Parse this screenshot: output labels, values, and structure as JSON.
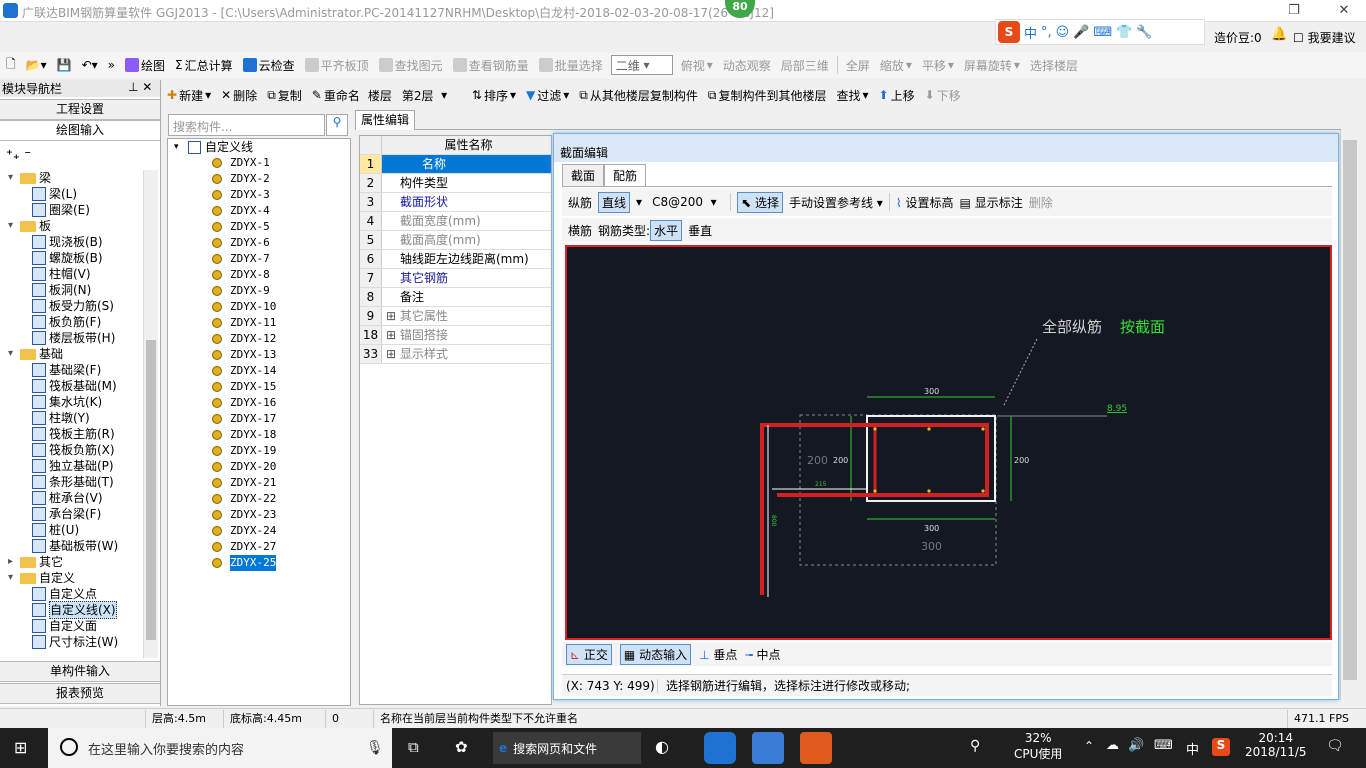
{
  "window": {
    "title": "广联达BIM钢筋算量软件 GGJ2013 - [C:\\Users\\Administrator.PC-20141127NRHM\\Desktop\\白龙村-2018-02-03-20-08-17(26  GGJ12]",
    "badge": "80"
  },
  "ime": {
    "lang": "中",
    "account": "造价豆:0",
    "suggest": "我要建议"
  },
  "toolbar1": {
    "draw": "绘图",
    "sum": "汇总计算",
    "cloud": "云检查",
    "flat": "平齐板顶",
    "find_elem": "查找图元",
    "view_rebar": "查看钢筋量",
    "batch": "批量选择",
    "view_mode": "二维",
    "top_view": "俯视",
    "dynamic": "动态观察",
    "local3d": "局部三维",
    "fullscreen": "全屏",
    "zoom": "缩放",
    "pan": "平移",
    "rotate": "屏幕旋转",
    "sel_floor": "选择楼层"
  },
  "toolbar2": {
    "new": "新建",
    "delete": "删除",
    "copy": "复制",
    "rename": "重命名",
    "floor_label": "楼层",
    "floor": "第2层",
    "sort": "排序",
    "filter": "过滤",
    "copy_from": "从其他楼层复制构件",
    "copy_to": "复制构件到其他楼层",
    "find": "查找",
    "up": "上移",
    "down": "下移"
  },
  "nav": {
    "header": "模块导航栏",
    "project": "工程设置",
    "draw_input": "绘图输入",
    "single": "单构件输入",
    "report": "报表预览",
    "tree": [
      {
        "label": "梁",
        "level": 0,
        "type": "folder"
      },
      {
        "label": "梁(L)",
        "level": 1
      },
      {
        "label": "圈梁(E)",
        "level": 1
      },
      {
        "label": "板",
        "level": 0,
        "type": "folder"
      },
      {
        "label": "现浇板(B)",
        "level": 1
      },
      {
        "label": "螺旋板(B)",
        "level": 1
      },
      {
        "label": "柱帽(V)",
        "level": 1
      },
      {
        "label": "板洞(N)",
        "level": 1
      },
      {
        "label": "板受力筋(S)",
        "level": 1
      },
      {
        "label": "板负筋(F)",
        "level": 1
      },
      {
        "label": "楼层板带(H)",
        "level": 1
      },
      {
        "label": "基础",
        "level": 0,
        "type": "folder"
      },
      {
        "label": "基础梁(F)",
        "level": 1
      },
      {
        "label": "筏板基础(M)",
        "level": 1
      },
      {
        "label": "集水坑(K)",
        "level": 1
      },
      {
        "label": "柱墩(Y)",
        "level": 1
      },
      {
        "label": "筏板主筋(R)",
        "level": 1
      },
      {
        "label": "筏板负筋(X)",
        "level": 1
      },
      {
        "label": "独立基础(P)",
        "level": 1
      },
      {
        "label": "条形基础(T)",
        "level": 1
      },
      {
        "label": "桩承台(V)",
        "level": 1
      },
      {
        "label": "承台梁(F)",
        "level": 1
      },
      {
        "label": "桩(U)",
        "level": 1
      },
      {
        "label": "基础板带(W)",
        "level": 1
      },
      {
        "label": "其它",
        "level": 0,
        "type": "folder"
      },
      {
        "label": "自定义",
        "level": 0,
        "type": "folder"
      },
      {
        "label": "自定义点",
        "level": 1
      },
      {
        "label": "自定义线(X)",
        "level": 1,
        "selected": true
      },
      {
        "label": "自定义面",
        "level": 1
      },
      {
        "label": "尺寸标注(W)",
        "level": 1
      }
    ]
  },
  "search": {
    "placeholder": "搜索构件..."
  },
  "components": {
    "root": "自定义线",
    "items": [
      "ZDYX-1",
      "ZDYX-2",
      "ZDYX-3",
      "ZDYX-4",
      "ZDYX-5",
      "ZDYX-6",
      "ZDYX-7",
      "ZDYX-8",
      "ZDYX-9",
      "ZDYX-10",
      "ZDYX-11",
      "ZDYX-12",
      "ZDYX-13",
      "ZDYX-14",
      "ZDYX-15",
      "ZDYX-16",
      "ZDYX-17",
      "ZDYX-18",
      "ZDYX-19",
      "ZDYX-20",
      "ZDYX-21",
      "ZDYX-22",
      "ZDYX-23",
      "ZDYX-24",
      "ZDYX-27",
      "ZDYX-25"
    ],
    "selected": "ZDYX-25"
  },
  "props": {
    "tab": "属性编辑",
    "header": "属性名称",
    "rows": [
      {
        "n": "1",
        "v": "名称",
        "style": "sel"
      },
      {
        "n": "2",
        "v": "构件类型",
        "style": ""
      },
      {
        "n": "3",
        "v": "截面形状",
        "style": "blue"
      },
      {
        "n": "4",
        "v": "截面宽度(mm)",
        "style": "gray"
      },
      {
        "n": "5",
        "v": "截面高度(mm)",
        "style": "gray"
      },
      {
        "n": "6",
        "v": "轴线距左边线距离(mm)",
        "style": ""
      },
      {
        "n": "7",
        "v": "其它钢筋",
        "style": "blue"
      },
      {
        "n": "8",
        "v": "备注",
        "style": ""
      },
      {
        "n": "9",
        "v": "其它属性",
        "style": "gray",
        "plus": true
      },
      {
        "n": "18",
        "v": "锚固搭接",
        "style": "gray",
        "plus": true
      },
      {
        "n": "33",
        "v": "显示样式",
        "style": "gray",
        "plus": true
      }
    ]
  },
  "dialog": {
    "title": "截面编辑",
    "tab1": "截面",
    "tab2": "配筋",
    "long_rebar": "纵筋",
    "line": "直线",
    "spec": "C8@200",
    "select": "选择",
    "manual_ref": "手动设置参考线",
    "set_elev": "设置标高",
    "show_mark": "显示标注",
    "delete": "删除",
    "trans": "横筋",
    "rebar_type": "钢筋类型:",
    "horizontal": "水平",
    "vertical": "垂直",
    "canvas": {
      "all_long": "全部纵筋",
      "by_section": "按截面",
      "dim_top": "300",
      "dim_bottom": "300",
      "dim_bottom2": "300",
      "dim_left": "200",
      "dim_left2": "200",
      "dim_right": "200",
      "elev": "8.95",
      "small1": "215",
      "small2": "800"
    },
    "ortho": "正交",
    "dyn_input": "动态输入",
    "perp": "垂点",
    "mid": "中点",
    "coord": "(X: 743 Y: 499)",
    "hint": "选择钢筋进行编辑，选择标注进行修改或移动;"
  },
  "status": {
    "floor_h": "层高:4.5m",
    "bottom_elev": "底标高:4.45m",
    "zero": "0",
    "msg": "名称在当前层当前构件类型下不允许重名",
    "fps": "471.1 FPS"
  },
  "taskbar": {
    "search": "在这里输入你要搜索的内容",
    "browser": "搜索网页和文件",
    "cpu": "32%",
    "cpu_label": "CPU使用",
    "lang": "中",
    "time": "20:14",
    "date": "2018/11/5"
  }
}
